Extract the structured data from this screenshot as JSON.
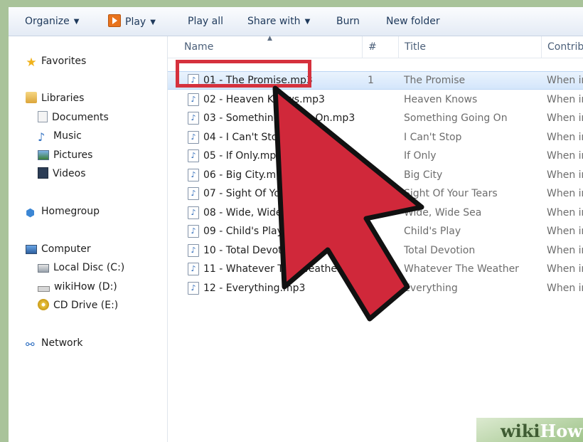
{
  "toolbar": {
    "organize": "Organize",
    "play": "Play",
    "play_all": "Play all",
    "share_with": "Share with",
    "burn": "Burn",
    "new_folder": "New folder"
  },
  "nav": {
    "favorites": "Favorites",
    "libraries": "Libraries",
    "documents": "Documents",
    "music": "Music",
    "pictures": "Pictures",
    "videos": "Videos",
    "homegroup": "Homegroup",
    "computer": "Computer",
    "local_disc": "Local Disc (C:)",
    "wikihow_drive": "wikiHow (D:)",
    "cd_drive": "CD Drive (E:)",
    "network": "Network"
  },
  "columns": {
    "name": "Name",
    "number": "#",
    "title": "Title",
    "contributing": "Contrib"
  },
  "files": [
    {
      "name": "01 - The Promise.mp3",
      "number": "1",
      "title": "The Promise",
      "contrib": "When in",
      "selected": true
    },
    {
      "name": "02 - Heaven Knows.mp3",
      "number": "",
      "title": "Heaven Knows",
      "contrib": "When in"
    },
    {
      "name": "03 - Something Going On.mp3",
      "number": "",
      "title": "Something Going On",
      "contrib": "When in"
    },
    {
      "name": "04 - I Can't Stop.mp3",
      "number": "",
      "title": "I Can't Stop",
      "contrib": "When in"
    },
    {
      "name": "05 - If Only.mp3",
      "number": "",
      "title": "If Only",
      "contrib": "When in"
    },
    {
      "name": "06 - Big City.mp3",
      "number": "",
      "title": "Big City",
      "contrib": "When in"
    },
    {
      "name": "07 - Sight Of Your Tears.mp3",
      "number": "",
      "title": "Sight Of Your Tears",
      "contrib": "When in"
    },
    {
      "name": "08 - Wide, Wide Sea.mp3",
      "number": "",
      "title": "Wide, Wide Sea",
      "contrib": "When in"
    },
    {
      "name": "09 - Child's Play.mp3",
      "number": "",
      "title": "Child's Play",
      "contrib": "When in"
    },
    {
      "name": "10 - Total Devotion.mp3",
      "number": "",
      "title": "Total Devotion",
      "contrib": "When in"
    },
    {
      "name": "11 - Whatever The Weather.mp3",
      "number": "",
      "title": "Whatever The Weather",
      "contrib": "When in"
    },
    {
      "name": "12 - Everything.mp3",
      "number": "",
      "title": "Everything",
      "contrib": "When in"
    }
  ],
  "watermark": {
    "wiki": "wiki",
    "how": "How"
  },
  "colors": {
    "highlight": "#d5313d",
    "pointer": "#d0283a",
    "selection": "#d4e6fb"
  }
}
